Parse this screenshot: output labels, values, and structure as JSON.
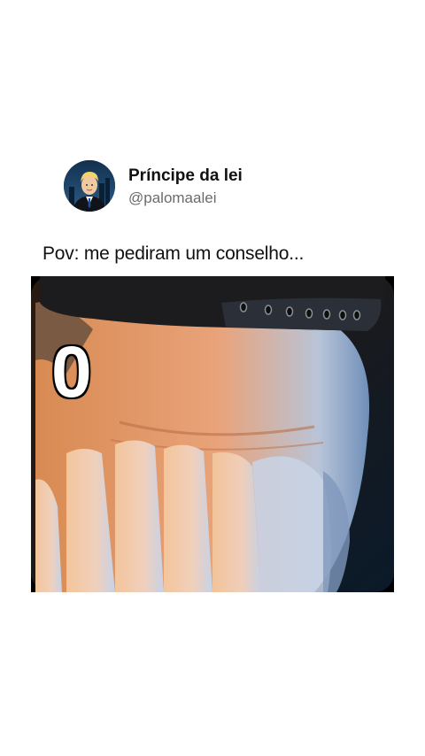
{
  "profile": {
    "display_name": "Príncipe da lei",
    "handle": "@palomaalei",
    "avatar_icon": "cartoon-man-suit-avatar"
  },
  "post": {
    "text": "Pov: me pediram um conselho...",
    "media": {
      "description_icon": "man-covering-face-icon",
      "overlay_text": "0"
    }
  }
}
